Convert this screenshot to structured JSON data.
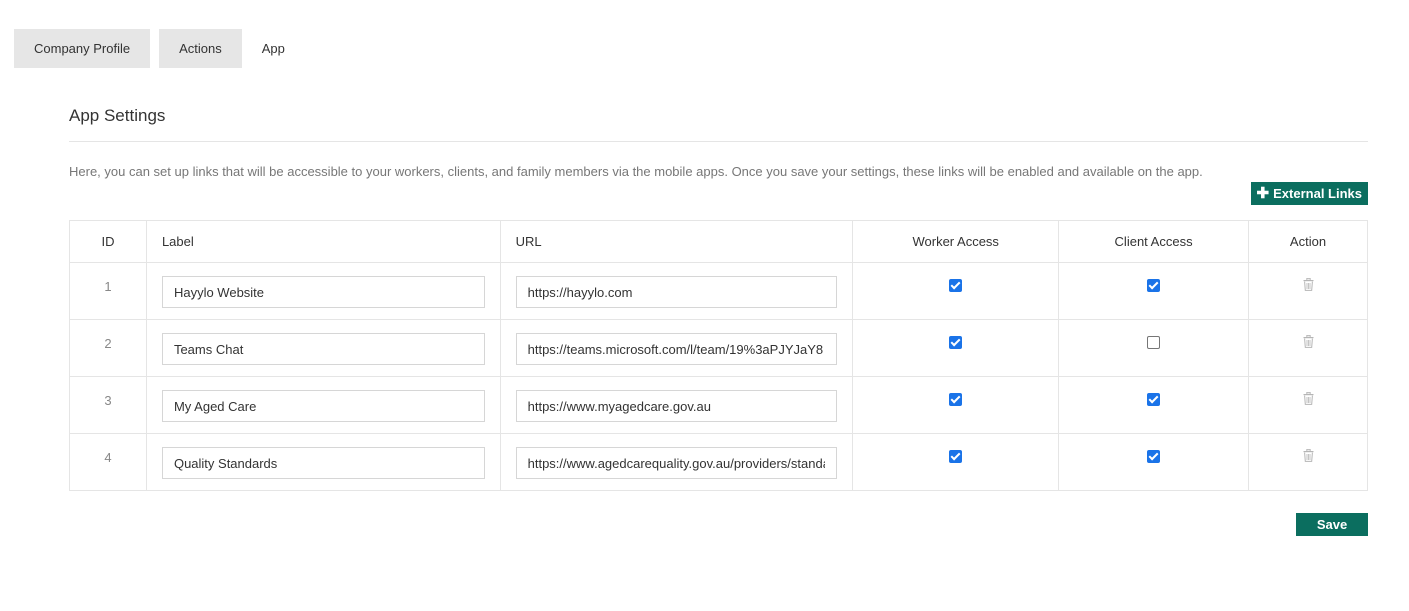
{
  "tabs": [
    {
      "label": "Company Profile",
      "active": false
    },
    {
      "label": "Actions",
      "active": false
    },
    {
      "label": "App",
      "active": true
    }
  ],
  "section": {
    "title": "App Settings",
    "description": "Here, you can set up links that will be accessible to your workers, clients, and family members via the mobile apps. Once you save your settings, these links will be enabled and available on the app."
  },
  "external_links_button": {
    "icon": "plus-icon",
    "label": "External Links"
  },
  "table": {
    "headers": {
      "id": "ID",
      "label": "Label",
      "url": "URL",
      "worker": "Worker Access",
      "client": "Client Access",
      "action": "Action"
    },
    "rows": [
      {
        "id": "1",
        "label": "Hayylo Website",
        "url": "https://hayylo.com",
        "worker_access": true,
        "client_access": true
      },
      {
        "id": "2",
        "label": "Teams Chat",
        "url": "https://teams.microsoft.com/l/team/19%3aPJYJaY8",
        "worker_access": true,
        "client_access": false
      },
      {
        "id": "3",
        "label": "My Aged Care",
        "url": "https://www.myagedcare.gov.au",
        "worker_access": true,
        "client_access": true
      },
      {
        "id": "4",
        "label": "Quality Standards",
        "url": "https://www.agedcarequality.gov.au/providers/standards",
        "worker_access": true,
        "client_access": true
      }
    ]
  },
  "save_button": {
    "label": "Save"
  },
  "colors": {
    "primary": "#0b6e5f",
    "checkbox_checked": "#1a73e8",
    "tab_inactive_bg": "#e6e6e6",
    "border": "#e5e5e5"
  }
}
